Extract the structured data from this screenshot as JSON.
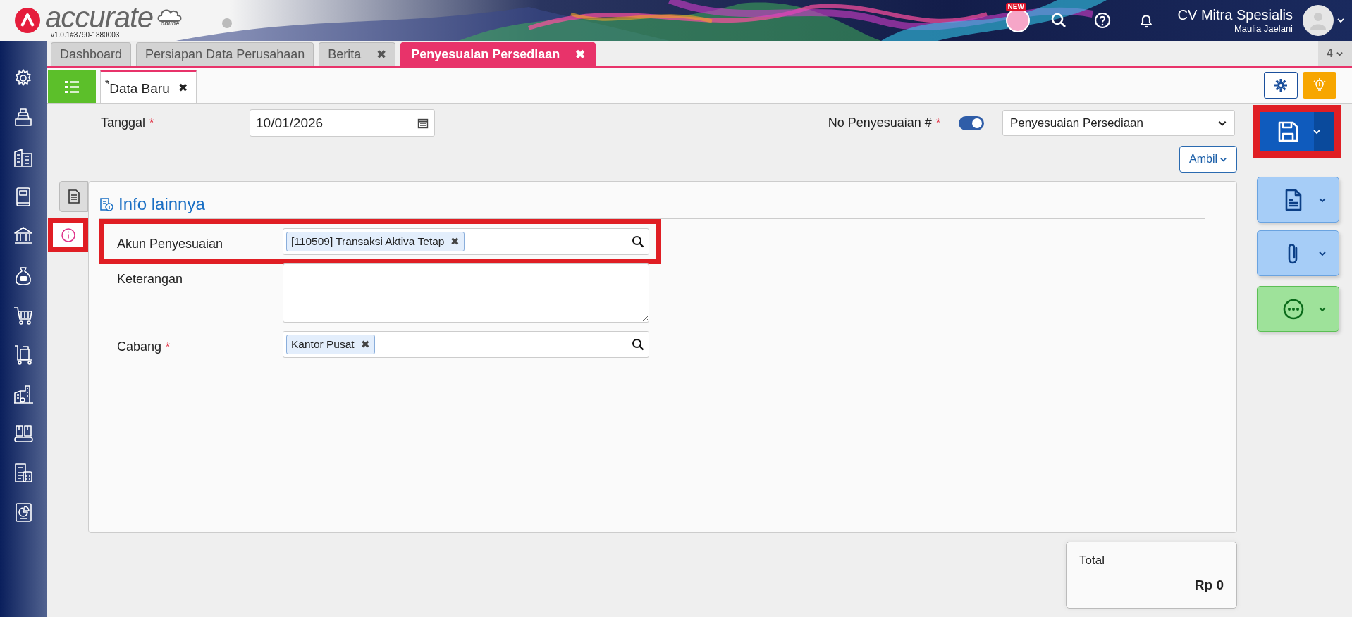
{
  "app": {
    "logo_text": "accurate",
    "logo_sub": "online",
    "version": "v1.0.1#3790-1880003"
  },
  "header": {
    "new_badge": "NEW",
    "company": "CV Mitra Spesialis",
    "user": "Maulia Jaelani"
  },
  "tabs": [
    {
      "label": "Dashboard",
      "selected": false
    },
    {
      "label": "Persiapan Data Perusahaan",
      "selected": false
    },
    {
      "label": "Berita",
      "selected": false,
      "close": "✖"
    },
    {
      "label": "Penyesuaian Persediaan",
      "selected": true,
      "close": "✖"
    }
  ],
  "tab_count": "4",
  "subtabs": [
    {
      "label": "$^{*}$Data Baru",
      "selected": true,
      "close": "✖"
    }
  ],
  "form": {
    "date": {
      "label": "Tanggal",
      "required_mark": "*",
      "value": "10/01/2026"
    },
    "number": {
      "label": "No Penyesuaian #",
      "required_mark": "*",
      "on": true,
      "type_value": "Penyesuaian Persediaan"
    },
    "fetch_button": "Ambil"
  },
  "side_tabs": [
    {
      "kind": "document",
      "selected": false,
      "highlighted": false
    },
    {
      "kind": "info",
      "selected": true,
      "highlighted": true
    }
  ],
  "panel": {
    "title": "Info lainnya",
    "fields": [
      {
        "kind": "lookup",
        "label": "Akun Penyesuaian",
        "highlighted": true,
        "chips": [
          {
            "label": "[110509] Transaksi Aktiva Tetap",
            "close": "✖"
          }
        ]
      },
      {
        "kind": "textarea",
        "label": "Keterangan",
        "highlighted": false
      },
      {
        "kind": "lookup",
        "label": "Cabang",
        "required_mark": "*",
        "highlighted": false,
        "chips": [
          {
            "label": "Kantor Pusat",
            "close": "✖"
          }
        ]
      }
    ]
  },
  "actions": [
    {
      "kind": "save",
      "highlighted": true
    },
    {
      "kind": "document",
      "highlighted": false
    },
    {
      "kind": "attachment",
      "highlighted": false
    },
    {
      "kind": "more",
      "highlighted": false
    }
  ],
  "total": {
    "label": "Total",
    "value": "Rp 0"
  }
}
